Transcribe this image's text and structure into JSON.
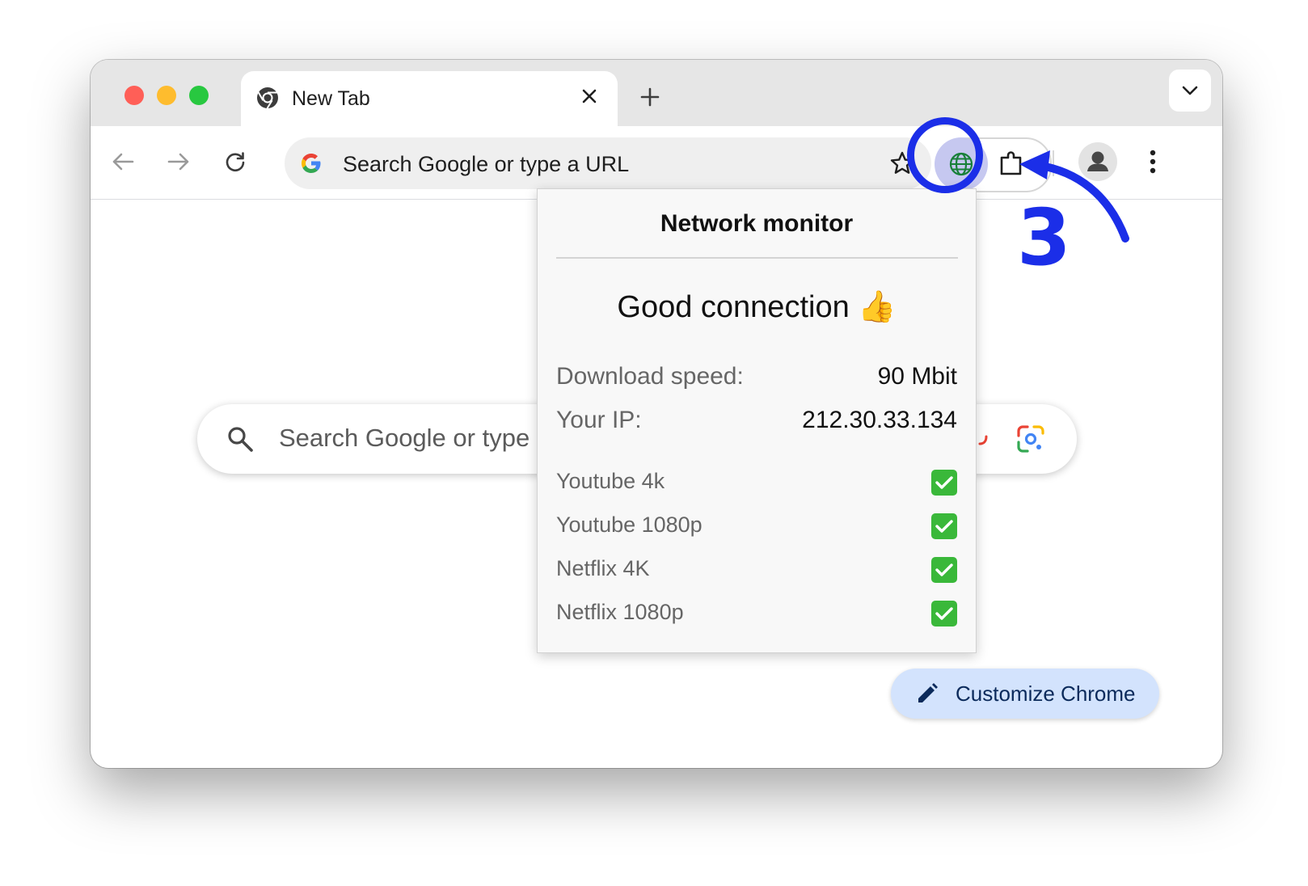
{
  "tab": {
    "title": "New Tab"
  },
  "omnibox": {
    "text": "Search Google or type a URL"
  },
  "popup": {
    "title": "Network monitor",
    "status": "Good connection 👍",
    "stats": [
      {
        "label": "Download speed:",
        "value": "90 Mbit"
      },
      {
        "label": "Your IP:",
        "value": "212.30.33.134"
      }
    ],
    "services": [
      {
        "label": "Youtube 4k",
        "ok": true
      },
      {
        "label": "Youtube 1080p",
        "ok": true
      },
      {
        "label": "Netflix 4K",
        "ok": true
      },
      {
        "label": "Netflix 1080p",
        "ok": true
      }
    ]
  },
  "ntp": {
    "search_placeholder": "Search Google or type a URL",
    "customize_label": "Customize Chrome"
  },
  "annotation": {
    "step_number": "3",
    "color": "#1b2ee8"
  },
  "colors": {
    "accent": "#1b2ee8",
    "check_green": "#3ab83a",
    "customize_bg": "#d3e3fd"
  }
}
